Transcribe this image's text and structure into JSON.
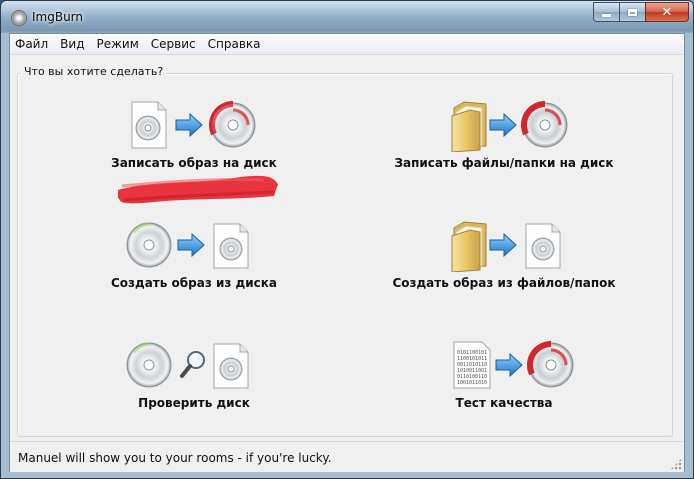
{
  "window": {
    "title": "ImgBurn",
    "app_icon": "disc-burn-icon",
    "caption_close": "✕"
  },
  "menu": [
    {
      "label": "Файл"
    },
    {
      "label": "Вид"
    },
    {
      "label": "Режим"
    },
    {
      "label": "Сервис"
    },
    {
      "label": "Справка"
    }
  ],
  "group": {
    "legend": "Что вы хотите сделать?"
  },
  "actions": [
    {
      "label": "Записать образ на диск",
      "icons": [
        "image-file-icon",
        "arrow-right-icon",
        "burn-disc-icon"
      ]
    },
    {
      "label": "Записать файлы/папки на диск",
      "icons": [
        "folder-icon",
        "arrow-right-icon",
        "burn-disc-icon"
      ]
    },
    {
      "label": "Создать образ из диска",
      "icons": [
        "disc-icon",
        "arrow-right-icon",
        "image-file-icon"
      ]
    },
    {
      "label": "Создать образ из файлов/папок",
      "icons": [
        "folder-icon",
        "arrow-right-icon",
        "image-file-icon"
      ]
    },
    {
      "label": "Проверить диск",
      "icons": [
        "disc-icon",
        "magnifier-icon",
        "image-file-icon"
      ]
    },
    {
      "label": "Тест качества",
      "icons": [
        "data-page-icon",
        "arrow-right-icon",
        "burn-disc-icon"
      ]
    }
  ],
  "colors": {
    "arrow": "#2f8fd8",
    "scribble": "#e8232f",
    "burn_mark": "#d0262e"
  },
  "statusbar": {
    "text": "Manuel will show you to your rooms - if you're lucky."
  }
}
